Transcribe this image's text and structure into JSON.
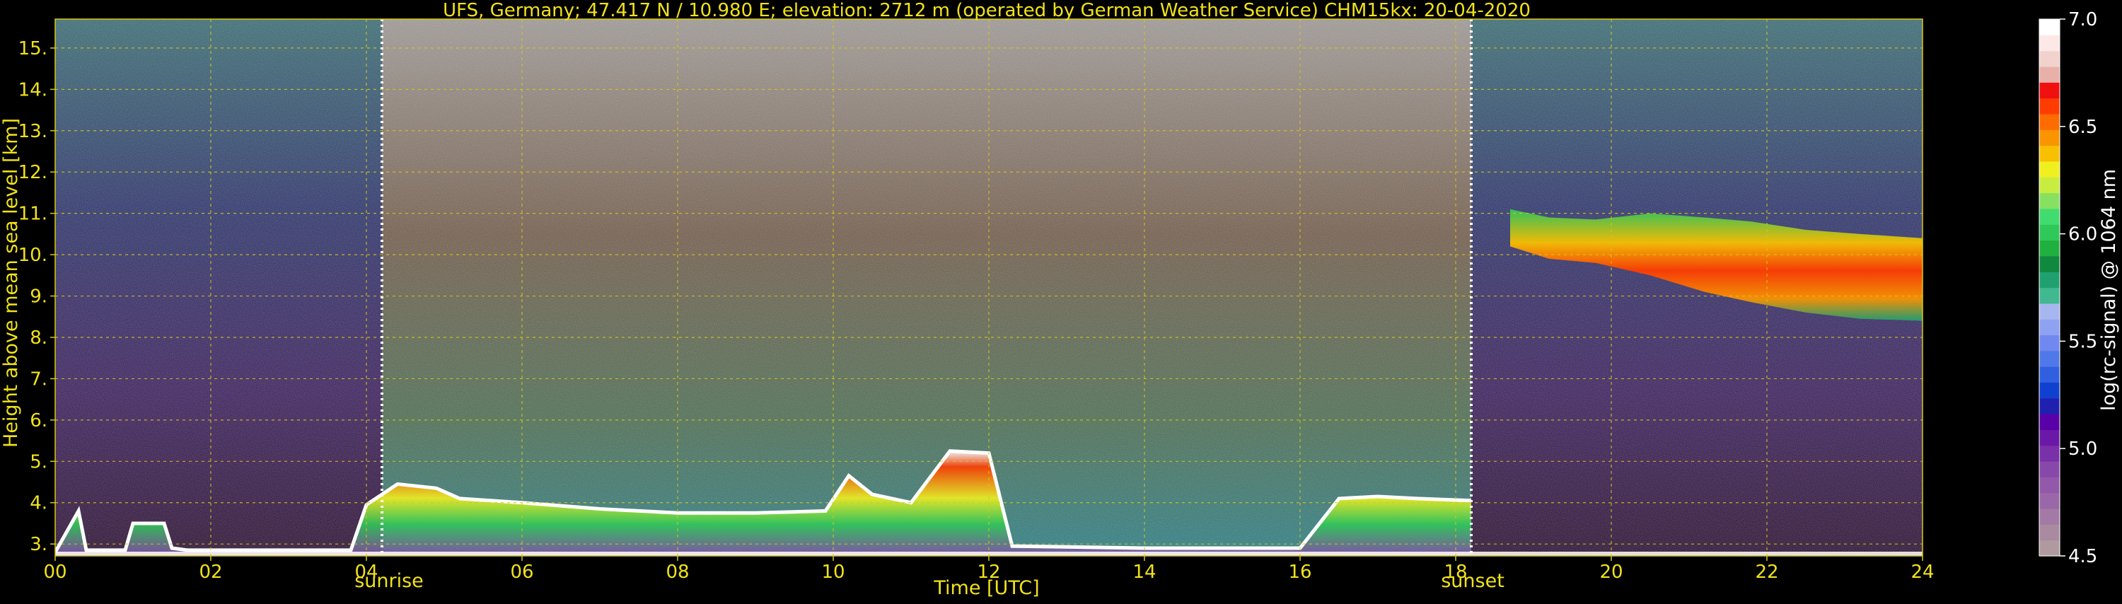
{
  "chart_data": {
    "type": "heatmap",
    "title": "UFS, Germany; 47.417 N / 10.980 E; elevation: 2712 m  (operated by German Weather Service)    CHM15kx: 20-04-2020",
    "xlabel": "Time [UTC]",
    "ylabel": "Height above mean sea level [km]",
    "xlim": [
      0,
      24
    ],
    "ylim": [
      2.712,
      15.7
    ],
    "x_ticks": [
      0,
      2,
      4,
      6,
      8,
      10,
      12,
      14,
      16,
      18,
      20,
      22,
      24
    ],
    "x_tick_labels": [
      "00",
      "02",
      "04",
      "06",
      "08",
      "10",
      "12",
      "14",
      "16",
      "18",
      "20",
      "22",
      "24"
    ],
    "y_ticks": [
      3,
      4,
      5,
      6,
      7,
      8,
      9,
      10,
      11,
      12,
      13,
      14,
      15
    ],
    "y_tick_labels": [
      "3.",
      "4.",
      "5.",
      "6.",
      "7.",
      "8.",
      "9.",
      "10.",
      "11.",
      "12.",
      "13.",
      "14.",
      "15."
    ],
    "grid": true,
    "annotations": [
      {
        "text": "sunrise",
        "x": 4.2
      },
      {
        "text": "sunset",
        "x": 18.2
      }
    ],
    "colorbar": {
      "label": "log(rc-signal) @ 1064 nm",
      "range": [
        4.5,
        7.0
      ],
      "ticks": [
        4.5,
        5.0,
        5.5,
        6.0,
        6.5,
        7.0
      ],
      "tick_labels": [
        "4.5",
        "5.0",
        "5.5",
        "6.0",
        "6.5",
        "7.0"
      ],
      "colors": [
        "#b09aa0",
        "#a98aa0",
        "#a27aa5",
        "#9a68a8",
        "#9258aa",
        "#8848aa",
        "#7a30a8",
        "#6a18a8",
        "#5a00a8",
        "#2020b0",
        "#1040d0",
        "#3060e0",
        "#5078e8",
        "#7088f0",
        "#8ea2f2",
        "#a8b6f0",
        "#40b890",
        "#20a070",
        "#108840",
        "#20b040",
        "#30c858",
        "#40dc70",
        "#88e060",
        "#c8ec40",
        "#f0f020",
        "#f8c000",
        "#fa9400",
        "#fc6c00",
        "#ff3c00",
        "#f01010",
        "#e8b0a8",
        "#f2d2cc",
        "#fce8e6",
        "#ffffff"
      ]
    },
    "series": [
      {
        "name": "",
        "x": [
          0.0,
          0.3,
          0.4,
          0.9,
          1.0,
          1.4,
          1.5,
          1.7,
          3.8,
          4.0,
          4.4,
          4.9,
          5.2,
          6.0,
          7.0,
          8.0,
          9.0,
          9.9,
          10.2,
          10.5,
          11.0,
          11.5,
          12.0,
          12.3,
          14.0,
          16.0,
          16.5,
          17.0,
          17.5,
          18.2
        ],
        "y": [
          2.8,
          3.8,
          2.85,
          2.85,
          3.5,
          3.5,
          2.9,
          2.85,
          2.85,
          3.95,
          4.45,
          4.35,
          4.1,
          4.0,
          3.85,
          3.75,
          3.75,
          3.8,
          4.65,
          4.2,
          4.0,
          5.25,
          5.2,
          2.95,
          2.9,
          2.9,
          4.1,
          4.15,
          4.1,
          4.05
        ]
      },
      {
        "name": "",
        "x": [
          18.7,
          19.2,
          19.8,
          20.5,
          21.2,
          21.8,
          22.5,
          23.2,
          24.0
        ],
        "y": [
          11.1,
          10.9,
          10.85,
          11.0,
          10.9,
          10.8,
          10.6,
          10.5,
          10.4
        ]
      },
      {
        "name": "",
        "x": [
          18.7,
          19.2,
          19.8,
          20.5,
          21.2,
          21.8,
          22.5,
          23.2,
          24.0
        ],
        "y": [
          10.2,
          9.9,
          9.8,
          9.5,
          9.1,
          8.85,
          8.6,
          8.45,
          8.4
        ]
      }
    ]
  }
}
